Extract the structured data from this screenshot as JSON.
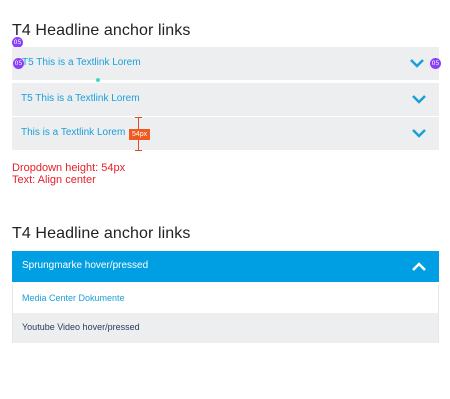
{
  "section1": {
    "title": "T4 Headline anchor links",
    "rows": [
      {
        "label": "T5 This is a Textlink Lorem"
      },
      {
        "label": "T5 This is a Textlink Lorem"
      },
      {
        "label": "This is a Textlink Lorem"
      }
    ],
    "measure_badge": "54px",
    "markers": {
      "title_dot": "05",
      "row_left_dot": "05",
      "row_right_dot": "05"
    },
    "notes": [
      "Dropdown height: 54px",
      "Text: Align center"
    ]
  },
  "section2": {
    "title": "T4 Headline anchor links",
    "header_label": "Sprungmarke hover/pressed",
    "items": [
      {
        "label": "Media Center Dokumente"
      },
      {
        "label": "Youtube Video hover/pressed"
      }
    ]
  },
  "colors": {
    "accent_blue": "#009fe3",
    "link_blue": "#1a9fd9",
    "row_gray": "#edeef0",
    "note_red": "#e8202a",
    "marker_purple": "#8a3ffc"
  },
  "icons": [
    "chevron-down-icon",
    "chevron-up-icon"
  ]
}
